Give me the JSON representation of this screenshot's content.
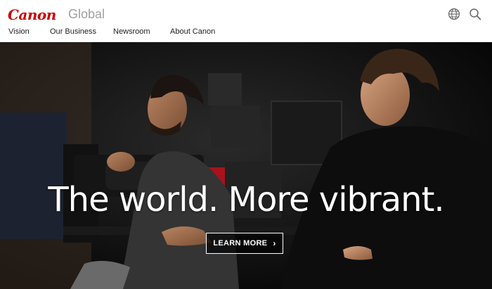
{
  "brand": {
    "logo_text": "Canon",
    "site_name": "Global",
    "brand_color": "#cc0000"
  },
  "nav": {
    "items": [
      "Vision",
      "Our Business",
      "Newsroom",
      "About Canon"
    ]
  },
  "header_icons": [
    "globe-icon",
    "search-icon"
  ],
  "hero": {
    "headline": "The world. More vibrant.",
    "cta_label": "LEARN MORE",
    "cta_icon": "chevron-right-icon"
  }
}
